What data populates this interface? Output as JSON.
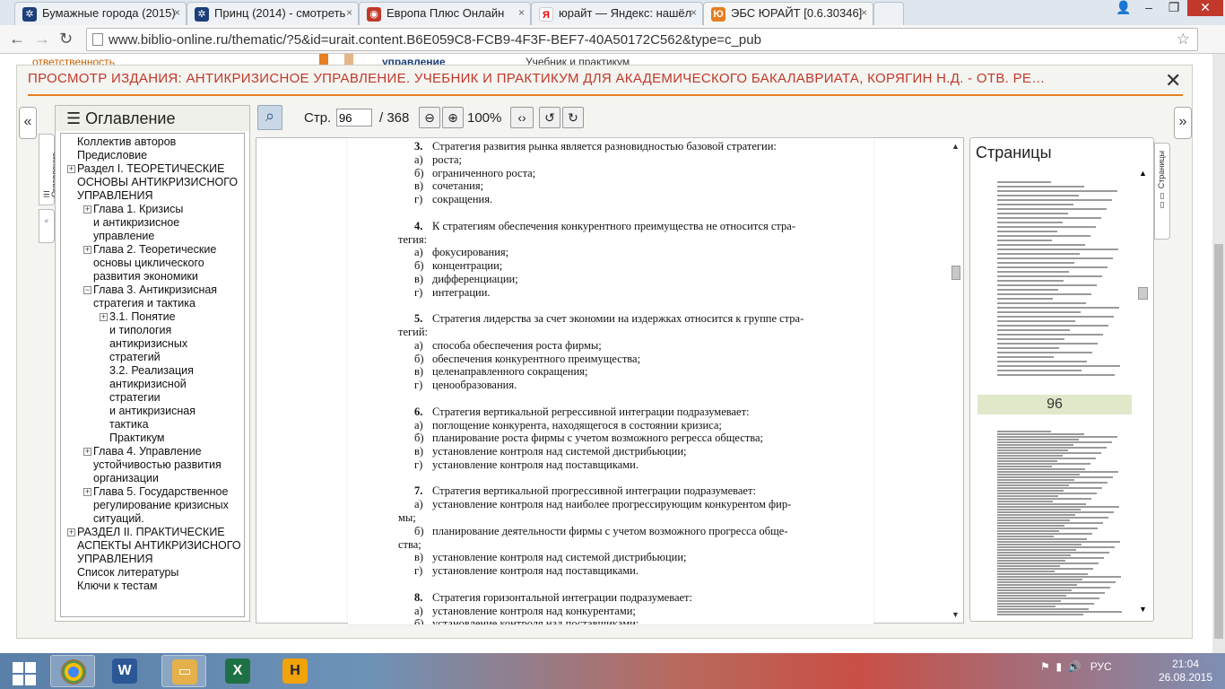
{
  "browser": {
    "tabs": [
      {
        "title": "Бумажные города (2015)",
        "icon": "film-icon"
      },
      {
        "title": "Принц (2014) - смотреть",
        "icon": "film-icon"
      },
      {
        "title": "Европа Плюс Онлайн",
        "icon": "radio-icon"
      },
      {
        "title": "юрайт — Яндекс: нашёл",
        "icon": "yandex-icon"
      },
      {
        "title": "ЭБС ЮРАЙТ [0.6.30346]",
        "icon": "urait-icon"
      }
    ],
    "url": "www.biblio-online.ru/thematic/?5&id=urait.content.B6E059C8-FCB9-4F3F-BEF7-40A50172C562&type=c_pub"
  },
  "background": {
    "left": "ответственность",
    "middle": "управление",
    "right": "Учебник и практикум"
  },
  "modal": {
    "title": "ПРОСМОТР ИЗДАНИЯ: АНТИКРИЗИСНОЕ УПРАВЛЕНИЕ. УЧЕБНИК И ПРАКТИКУМ ДЛЯ АКАДЕМИЧЕСКОГО БАКАЛАВРИАТА, КОРЯГИН Н.Д. - ОТВ. РЕ…",
    "close": "✕"
  },
  "side_tabs": {
    "toc": "☰ Оглавление",
    "pages": "▯▯ Страницы"
  },
  "toc": {
    "title": "Оглавление",
    "items": [
      "Коллектив авторов",
      "Предисловие",
      "Раздел I. ТЕОРЕТИЧЕСКИЕ",
      "ОСНОВЫ АНТИКРИЗИСНОГО",
      "УПРАВЛЕНИЯ",
      "Глава 1. Кризисы",
      "и антикризисное",
      "управление",
      "Глава 2. Теоретические",
      "основы циклического",
      "развития экономики",
      "Глава 3. Антикризисная",
      "стратегия и тактика",
      "3.1. Понятие",
      "и типология",
      "антикризисных",
      "стратегий",
      "3.2. Реализация",
      "антикризисной",
      "стратегии",
      "и антикризисная",
      "тактика",
      "Практикум",
      "Глава 4. Управление",
      "устойчивостью развития",
      "организации",
      "Глава 5. Государственное",
      "регулирование кризисных",
      "ситуаций.",
      "РАЗДЕЛ II. ПРАКТИЧЕСКИЕ",
      "АСПЕКТЫ АНТИКРИЗИСНОГО",
      "УПРАВЛЕНИЯ",
      "Список литературы",
      "Ключи к тестам"
    ]
  },
  "toolbar": {
    "page_label": "Стр.",
    "page_value": "96",
    "page_total": "/ 368",
    "zoom": "100%"
  },
  "document": {
    "lines": [
      {
        "n": "3.",
        "t": "Стратегия развития рынка является разновидностью базовой стратегии:"
      },
      {
        "n": "а)",
        "t": "роста;"
      },
      {
        "n": "б)",
        "t": "ограниченного роста;"
      },
      {
        "n": "в)",
        "t": "сочетания;"
      },
      {
        "n": "г)",
        "t": "сокращения."
      },
      {
        "n": "4.",
        "t": "К стратегиям обеспечения конкурентного преимущества не относится стра-"
      },
      {
        "n": "",
        "t": "тегия:"
      },
      {
        "n": "а)",
        "t": "фокусирования;"
      },
      {
        "n": "б)",
        "t": "концентрации;"
      },
      {
        "n": "в)",
        "t": "дифференциации;"
      },
      {
        "n": "г)",
        "t": "интеграции."
      },
      {
        "n": "5.",
        "t": "Стратегия лидерства за счет экономии на издержках относится к группе стра-"
      },
      {
        "n": "",
        "t": "тегий:"
      },
      {
        "n": "а)",
        "t": "способа обеспечения роста фирмы;"
      },
      {
        "n": "б)",
        "t": "обеспечения конкурентного преимущества;"
      },
      {
        "n": "в)",
        "t": "целенаправленного сокращения;"
      },
      {
        "n": "г)",
        "t": "ценообразования."
      },
      {
        "n": "6.",
        "t": "Стратегия вертикальной регрессивной интеграции подразумевает:"
      },
      {
        "n": "а)",
        "t": "поглощение конкурента, находящегося в состоянии кризиса;"
      },
      {
        "n": "б)",
        "t": "планирование роста фирмы с учетом возможного регресса общества;"
      },
      {
        "n": "в)",
        "t": "установление контроля над системой дистрибьюции;"
      },
      {
        "n": "г)",
        "t": "установление контроля над поставщиками."
      },
      {
        "n": "7.",
        "t": "Стратегия вертикальной прогрессивной интеграции подразумевает:"
      },
      {
        "n": "а)",
        "t": "установление контроля над наиболее прогрессирующим конкурентом фир-"
      },
      {
        "n": "",
        "t": "мы;"
      },
      {
        "n": "б)",
        "t": "планирование деятельности фирмы с учетом возможного прогресса обще-"
      },
      {
        "n": "",
        "t": "ства;"
      },
      {
        "n": "в)",
        "t": "установление контроля над системой дистрибьюции;"
      },
      {
        "n": "г)",
        "t": "установление контроля над поставщиками."
      },
      {
        "n": "8.",
        "t": "Стратегия горизонтальной интеграции подразумевает:"
      },
      {
        "n": "а)",
        "t": "установление контроля над конкурентами;"
      },
      {
        "n": "б)",
        "t": "установление контроля над поставщиками;"
      }
    ]
  },
  "pages_panel": {
    "title": "Страницы",
    "current_page": "96"
  },
  "taskbar": {
    "lang": "РУС",
    "time": "21:04",
    "date": "26.08.2015"
  }
}
